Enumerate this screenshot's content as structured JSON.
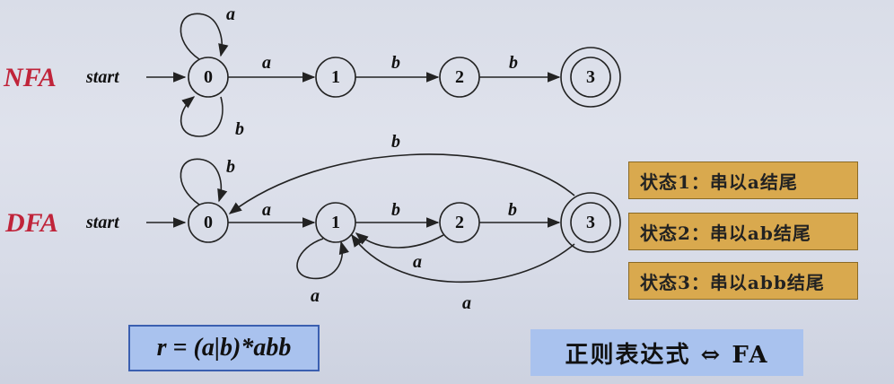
{
  "nfa": {
    "name": "NFA",
    "start_label": "start",
    "states": [
      "0",
      "1",
      "2",
      "3"
    ],
    "loop_top_label": "a",
    "loop_bottom_label": "b",
    "edges": [
      "a",
      "b",
      "b"
    ]
  },
  "dfa": {
    "name": "DFA",
    "start_label": "start",
    "states": [
      "0",
      "1",
      "2",
      "3"
    ],
    "loop0_label": "b",
    "loop1_label": "a",
    "edges": [
      "a",
      "b",
      "b"
    ],
    "back_3_to_0": "b",
    "back_2_to_1": "a",
    "back_3_to_1": "a"
  },
  "notes": [
    "状态1：串以a结尾",
    "状态2：串以ab结尾",
    "状态3：串以abb结尾"
  ],
  "regex": "r = (a|b)*abb",
  "equivalence": "正则表达式 ⇔ FA"
}
